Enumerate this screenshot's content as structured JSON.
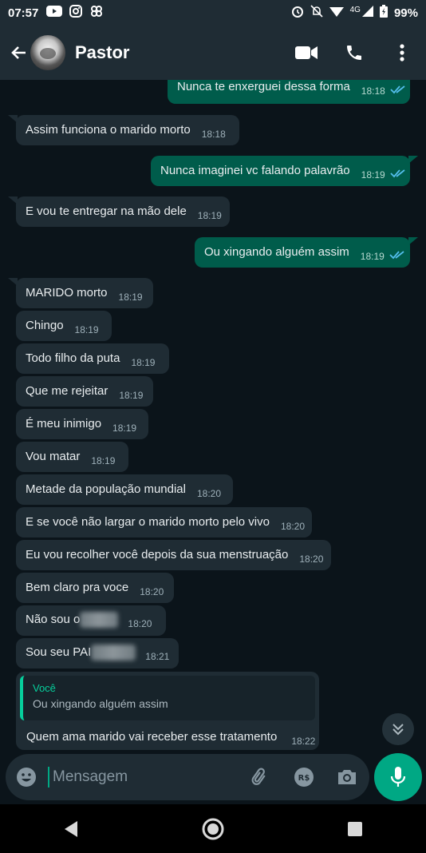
{
  "status_bar": {
    "time": "07:57",
    "network": "4G",
    "battery": "99%",
    "left_icons": [
      "youtube-icon",
      "instagram-icon",
      "app-icon"
    ],
    "right_icons": [
      "alarm-icon",
      "mute-icon",
      "wifi-icon",
      "signal-icon",
      "battery-icon"
    ]
  },
  "header": {
    "contact_name": "Pastor",
    "actions": [
      "video-call-icon",
      "voice-call-icon",
      "more-icon"
    ]
  },
  "messages": [
    {
      "dir": "out",
      "text": "Nunca te enxerguei dessa forma",
      "time": "18:18",
      "read": true
    },
    {
      "dir": "in",
      "text": "Assim funciona o marido morto",
      "time": "18:18"
    },
    {
      "dir": "out",
      "text": "Nunca imaginei vc falando palavrão",
      "time": "18:19",
      "read": true
    },
    {
      "dir": "in",
      "text": "E vou te entregar na mão dele",
      "time": "18:19"
    },
    {
      "dir": "out",
      "text": "Ou xingando alguém assim",
      "time": "18:19",
      "read": true
    },
    {
      "dir": "in",
      "text": "MARIDO morto",
      "time": "18:19"
    },
    {
      "dir": "in",
      "text": "Chingo",
      "time": "18:19"
    },
    {
      "dir": "in",
      "text": "Todo filho da puta",
      "time": "18:19"
    },
    {
      "dir": "in",
      "text": "Que me rejeitar",
      "time": "18:19"
    },
    {
      "dir": "in",
      "text": "É meu inimigo",
      "time": "18:19"
    },
    {
      "dir": "in",
      "text": "Vou matar",
      "time": "18:19"
    },
    {
      "dir": "in",
      "text": "Metade da população mundial",
      "time": "18:20"
    },
    {
      "dir": "in",
      "text": "E se você não largar o marido morto pelo vivo",
      "time": "18:20"
    },
    {
      "dir": "in",
      "text": "Eu vou recolher você depois da sua menstruação",
      "time": "18:20"
    },
    {
      "dir": "in",
      "text": "Bem claro pra voce",
      "time": "18:20"
    },
    {
      "dir": "in",
      "text": "Não sou o",
      "time": "18:20",
      "redacted": true
    },
    {
      "dir": "in",
      "text": "Sou seu PAI",
      "time": "18:21",
      "redacted": true
    }
  ],
  "reply_message": {
    "quoted_author": "Você",
    "quoted_text": "Ou xingando alguém assim",
    "text": "Quem ama marido vai receber esse tratamento",
    "time": "18:22"
  },
  "composer": {
    "placeholder": "Mensagem",
    "icons": [
      "emoji-icon",
      "attach-icon",
      "payment-icon",
      "camera-icon",
      "mic-icon"
    ]
  },
  "colors": {
    "background": "#0b141a",
    "incoming_bubble": "#1f2c34",
    "outgoing_bubble": "#005c4b",
    "accent": "#00a884",
    "read_ticks": "#53bdeb"
  }
}
